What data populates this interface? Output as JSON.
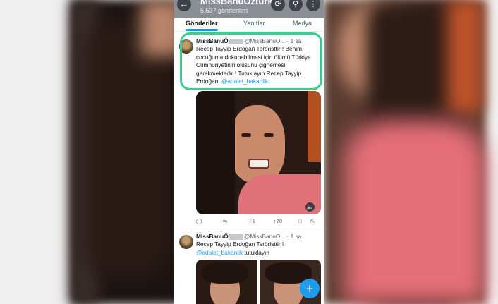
{
  "profile": {
    "name": "MissBanuÖzturk",
    "posts_count": "5.537 gönderileri"
  },
  "tabs": [
    "Gönderiler",
    "Yanıtlar",
    "Medya"
  ],
  "tweets": [
    {
      "name": "MissBanuÖ",
      "handle": "@MissBanuO...",
      "time": "· 1 sa",
      "text": "Recep Tayyip Erdoğan Teröristtir ! Benim çocuğuma dokunabilmesi için ölümü Türkiye Cumhuriyetinin ölüsünü çiğnemesi gerekmektedir ! Tutuklayın Recep Tayyip Erdoğanı",
      "mention": "@adalet_bakanlik",
      "stats": {
        "likes": "1",
        "views": "70"
      }
    },
    {
      "name": "MissBanuÖ",
      "handle": "@MissBanuO...",
      "time": "· 1 sa",
      "text": "Recep Tayyip Erdoğan Teröristtir !",
      "mention": "@adalet_bakanlik",
      "text_after": "tutuklayın"
    }
  ],
  "colors": {
    "accent": "#1d9bf0",
    "highlight": "#2fd48a"
  }
}
